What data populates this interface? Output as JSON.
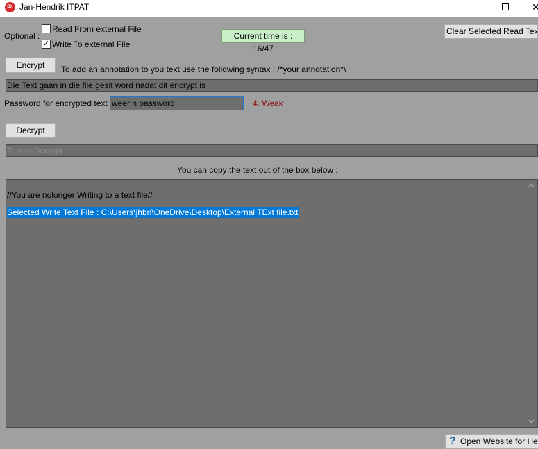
{
  "window": {
    "title": "Jan-Hendrik ITPAT",
    "icon_text": "DX",
    "minimize_icon": "minimize-icon",
    "maximize_icon": "maximize-icon",
    "close_icon": "close-icon",
    "close_glyph": "✕"
  },
  "options": {
    "label": "Optional :",
    "read_external": {
      "label": "Read From external File",
      "checked": false
    },
    "write_external": {
      "label": "Write To external File",
      "checked": true,
      "check_glyph": "✓"
    }
  },
  "time": {
    "text": "Current time is : 16/47"
  },
  "clear_button": {
    "label": "Clear Selected Read Text File"
  },
  "encrypt": {
    "button_label": "Encrypt",
    "hint": "To add an annotation to you text use the following syntax : /*your annotation*\\",
    "input_value": "Die Text gaan in die file gesit word nadat dit encrypt is"
  },
  "password": {
    "label": "Password for encrypted text :",
    "value": "weer n password",
    "strength": "4. Weak",
    "strength_color": "#8b0d0d"
  },
  "decrypt": {
    "button_label": "Decrypt",
    "placeholder": "Text to Decrypt"
  },
  "output": {
    "caption": "You can copy the text out of the box below :",
    "line1": "//You are nolonger Writing to a text file//",
    "line2": "Selected Write Text File : C:\\Users\\jhbri\\OneDrive\\Desktop\\External TExt file.txt"
  },
  "help": {
    "label": "Open Website for Help",
    "icon": "help-question-icon",
    "icon_glyph": "?"
  },
  "colors": {
    "background": "#a0a0a0",
    "field": "#6e6e6e",
    "selection": "#0078d7",
    "time_box": "#c9efc9"
  }
}
